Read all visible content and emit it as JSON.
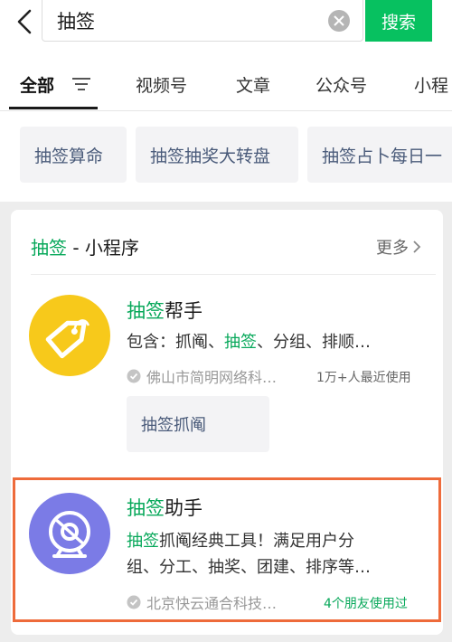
{
  "search": {
    "query": "抽签",
    "button_label": "搜索"
  },
  "tabs": [
    {
      "label": "全部"
    },
    {
      "label": "视频号"
    },
    {
      "label": "文章"
    },
    {
      "label": "公众号"
    },
    {
      "label": "小程"
    }
  ],
  "suggestions": [
    "抽签算命",
    "抽签抽奖大转盘",
    "抽签占卜每日一"
  ],
  "section": {
    "title_highlight": "抽签",
    "title_rest": " - 小程序",
    "more_label": "更多"
  },
  "apps": [
    {
      "name_highlight": "抽签",
      "name_rest": "帮手",
      "desc_prefix": "包含：抓阄、",
      "desc_highlight": "抽签",
      "desc_suffix": "、分组、排顺…",
      "publisher": "佛山市简明网络科…",
      "usage": "1万+人最近使用",
      "service_label": "抽签抓阄",
      "logo_color": "#f7c91b"
    },
    {
      "name_highlight": "抽签",
      "name_rest": "助手",
      "desc_highlight": "抽签",
      "desc_line1_rest": "抓阄经典工具！满足用户分",
      "desc_line2": "组、分工、抽奖、团建、排序等…",
      "publisher": "北京快云通合科技…",
      "friends": "4个朋友使用过",
      "logo_color": "#7b7be6"
    }
  ],
  "colors": {
    "accent_green": "#07c160",
    "highlight_border": "#ee6b3b"
  }
}
